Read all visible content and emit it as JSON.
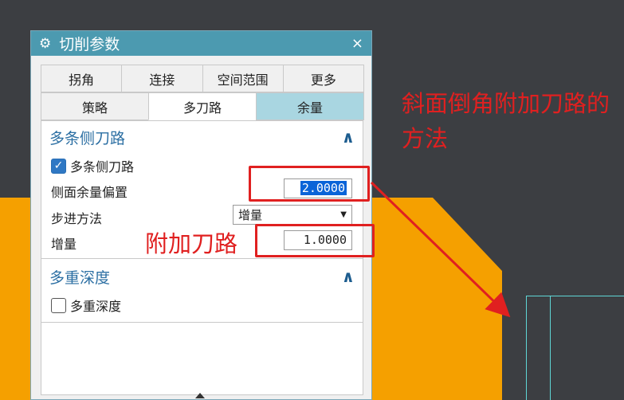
{
  "dialog": {
    "title": "切削参数",
    "close_glyph": "×",
    "gear_glyph": "⚙"
  },
  "tabs": {
    "row1": [
      "拐角",
      "连接",
      "空间范围",
      "更多"
    ],
    "row2": [
      "策略",
      "多刀路",
      "余量"
    ],
    "active": "多刀路"
  },
  "section_multi_side": {
    "title": "多条侧刀路",
    "checkbox_label": "多条侧刀路",
    "checked": true,
    "side_stock_offset_label": "侧面余量偏置",
    "side_stock_offset_value": "2.0000",
    "step_method_label": "步进方法",
    "step_method_value": "增量",
    "increment_label": "增量",
    "increment_value": "1.0000"
  },
  "section_multi_depth": {
    "title": "多重深度",
    "checkbox_label": "多重深度",
    "checked": false
  },
  "annotations": {
    "main_note": "斜面倒角附加刀路的方法",
    "side_note": "附加刀路",
    "color": "#e02020"
  },
  "colors": {
    "titlebar": "#4c9ab0",
    "tab_highlight": "#a9d6e1",
    "section_header": "#2c6fa3",
    "cad_part": "#f5a000",
    "cad_background": "#3c3e42",
    "cad_edge": "#5fd6d6"
  }
}
